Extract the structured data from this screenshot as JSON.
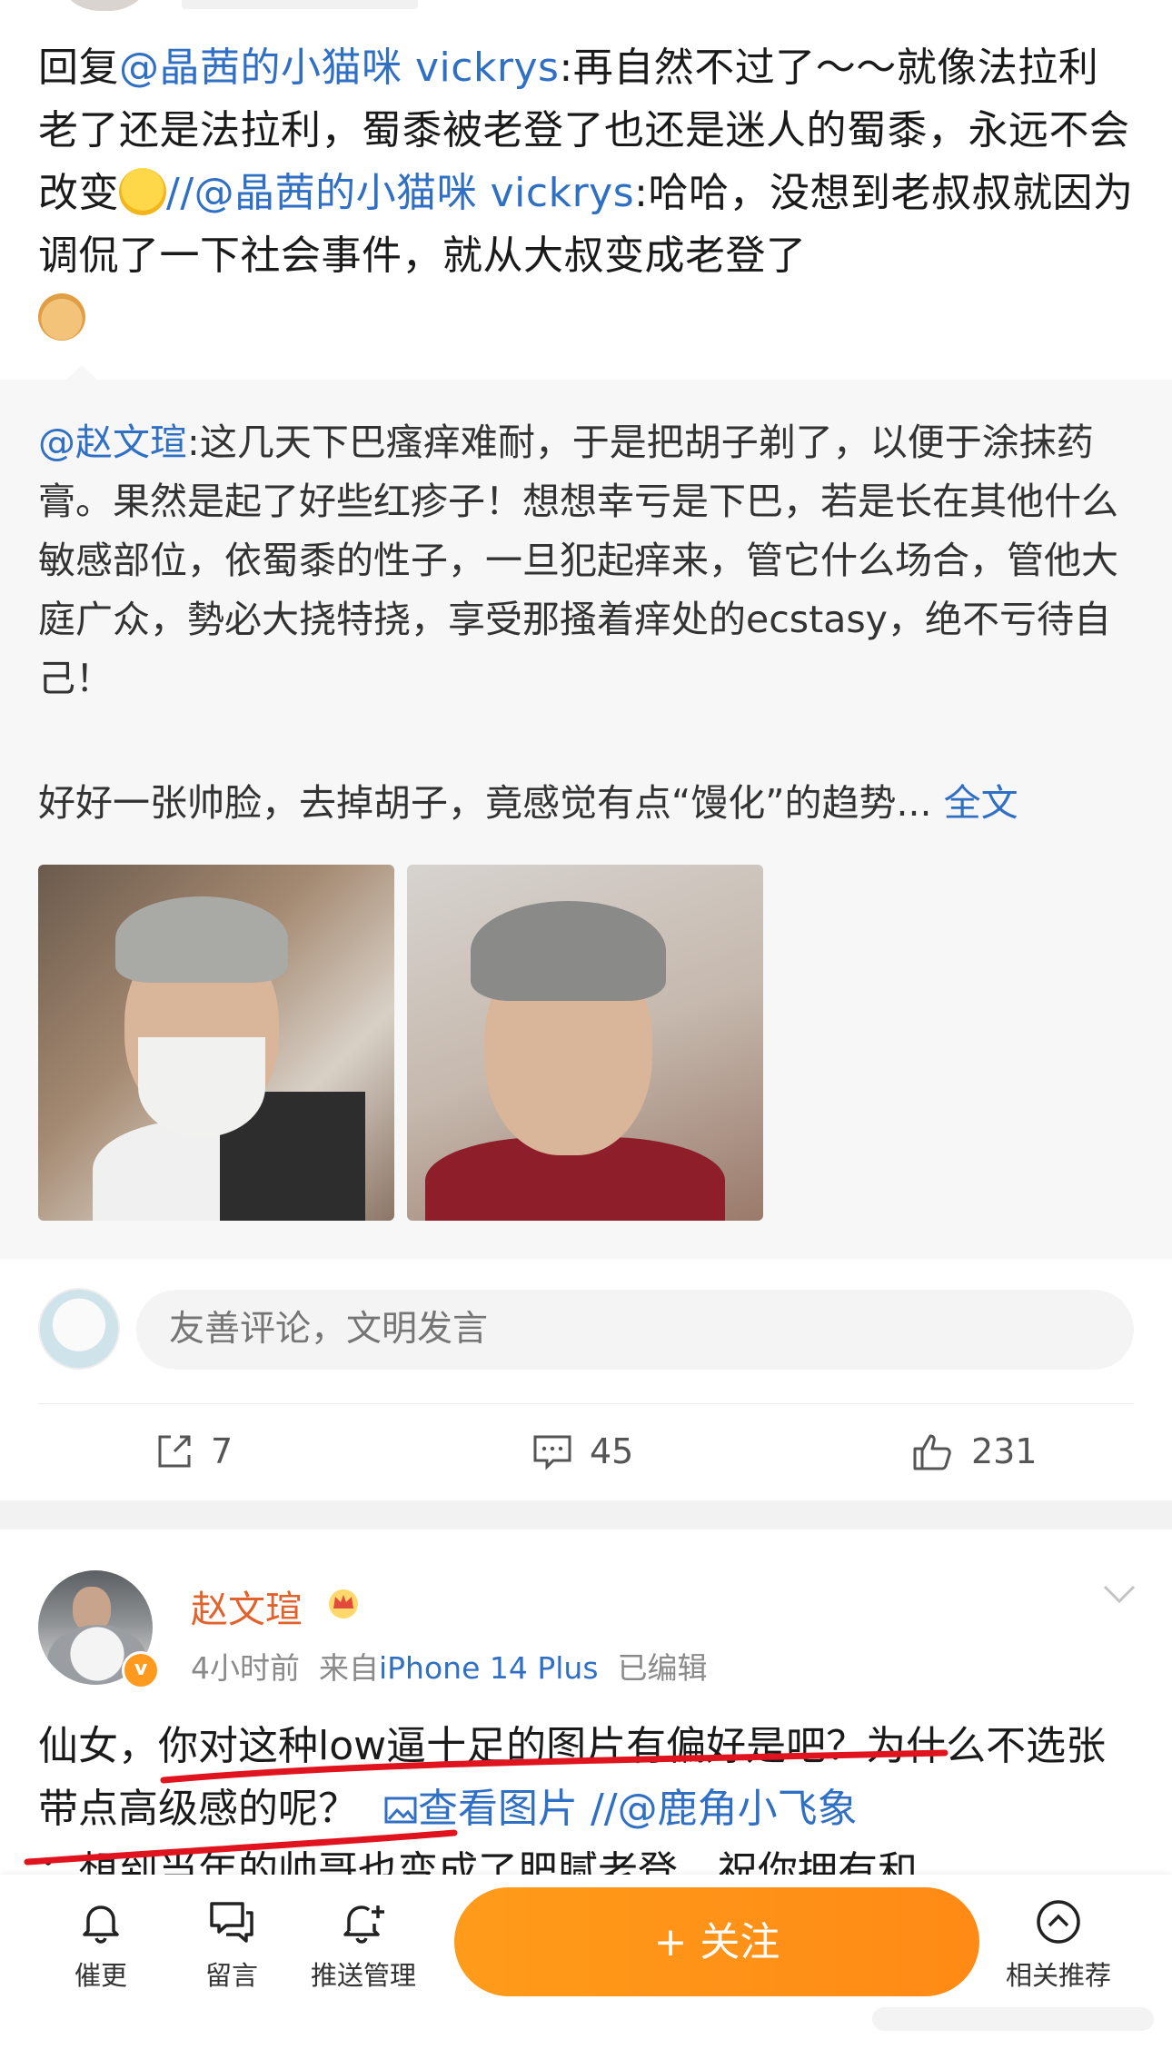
{
  "reply": {
    "prefix": "回复",
    "mention_1": "@晶茜的小猫咪 vickrys",
    "text_1": ":再自然不过了～～就像法拉利老了还是法拉利，蜀黍被老登了也还是迷人的蜀黍，永远不会改变",
    "separator": "//",
    "mention_2": "@晶茜的小猫咪 vickrys",
    "text_2": ":哈哈，没想到老叔叔就因为调侃了一下社会事件，就从大叔变成老登了"
  },
  "quoted_post": {
    "mention": "@赵文瑄",
    "text": ":这几天下巴瘙痒难耐，于是把胡子剃了，以便于涂抹药膏。果然是起了好些红疹子！想想幸亏是下巴，若是长在其他什么敏感部位，依蜀黍的性子，一旦犯起痒来，管它什么场合，管他大庭广众，勢必大挠特挠，享受那搔着痒处的ecstasy，绝不亏待自己！",
    "teaser": "好好一张帅脸，去掉胡子，竟感觉有点“馒化”的趋势...",
    "full_text_link": "全文"
  },
  "comment_input": {
    "placeholder": "友善评论，文明发言"
  },
  "actions": {
    "share_count": "7",
    "comment_count": "45",
    "like_count": "231"
  },
  "post": {
    "author": "赵文瑄",
    "verified_badge": "v",
    "time": "4小时前",
    "source_prefix": "来自",
    "source": "iPhone 14 Plus",
    "edited": "已编辑",
    "body_1": "仙女，你对这种low逼十足的图片有偏好是吧？为什么不选张带点高级感的呢？",
    "view_image": "查看图片",
    "separator": "//",
    "mention": "@鹿角小飞象",
    "body_cut": "：想到当年的帅哥也变成了肥腻老登，祝你拥有和"
  },
  "toolbar": {
    "remind_label": "催更",
    "message_label": "留言",
    "push_label": "推送管理",
    "follow_label": "+ 关注",
    "related_label": "相关推荐"
  },
  "colors": {
    "mention": "#2f6fc4",
    "author": "#e2622d",
    "follow_button": "#ff9a1a",
    "underline": "#e0141e"
  }
}
